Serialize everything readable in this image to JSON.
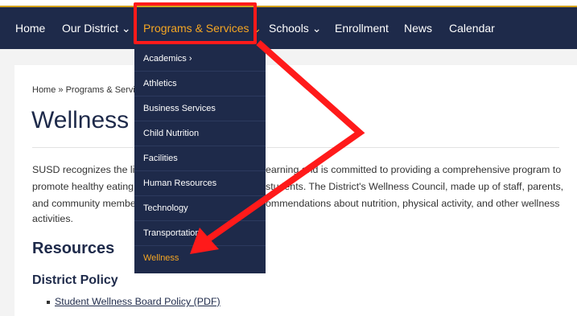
{
  "nav": {
    "items": [
      {
        "label": "Home"
      },
      {
        "label": "Our District ⌄"
      },
      {
        "label": "Programs & Services ⌄"
      },
      {
        "label": "Schools ⌄"
      },
      {
        "label": "Enrollment"
      },
      {
        "label": "News"
      },
      {
        "label": "Calendar"
      }
    ]
  },
  "dropdown": {
    "items": [
      {
        "label": "Academics ›"
      },
      {
        "label": "Athletics"
      },
      {
        "label": "Business Services"
      },
      {
        "label": "Child Nutrition"
      },
      {
        "label": "Facilities"
      },
      {
        "label": "Human Resources"
      },
      {
        "label": "Technology"
      },
      {
        "label": "Transportation"
      },
      {
        "label": "Wellness"
      }
    ]
  },
  "breadcrumb": {
    "home": "Home",
    "separator": " » ",
    "current": "Programs & Servic"
  },
  "page": {
    "title": "Wellness",
    "paragraph_lines": [
      "SUSD recognizes the lin",
      "promote healthy eating a",
      "and community member",
      "activities."
    ],
    "paragraph_lines_right": [
      "earning and is committed to providing a comprehensive program to",
      "students. The District's Wellness Council, made up of staff, parents,",
      "ommendations about nutrition, physical activity, and other wellness"
    ],
    "resources_heading": "Resources",
    "policy_heading": "District Policy",
    "policy_link": "Student Wellness Board Policy (PDF)"
  },
  "colors": {
    "nav_bg": "#1e2a4a",
    "accent": "#f5a623",
    "annotation": "#ff1a1a"
  }
}
